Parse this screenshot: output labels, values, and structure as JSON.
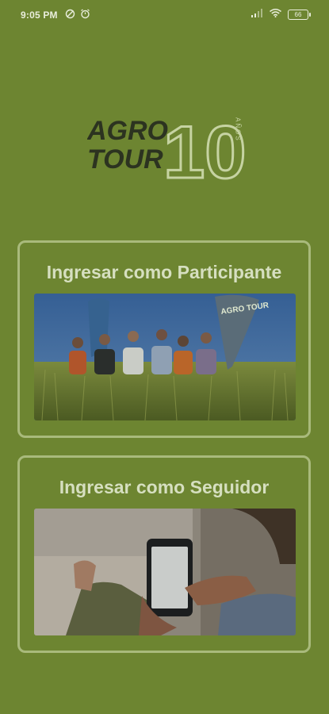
{
  "status_bar": {
    "time": "9:05 PM",
    "left_icons": [
      "at-sign-icon",
      "alarm-icon"
    ],
    "right_icons": [
      "signal-icon",
      "wifi-icon",
      "battery-icon"
    ],
    "battery_level": "66"
  },
  "logo": {
    "line1": "AGRO",
    "line2": "TOUR",
    "number": "10",
    "suffix": "AÑOS"
  },
  "participant_card": {
    "title": "Ingresar como Participante",
    "image_icon": "group-in-wheat-field-photo",
    "flag_text": "AGRO TOUR"
  },
  "follower_card": {
    "title": "Ingresar como Seguidor",
    "image_icon": "person-holding-phone-photo"
  },
  "colors": {
    "background": "#6d8531",
    "card_border": "#a9ba7c",
    "title_text": "#d6dfc0",
    "logo_dark": "#2c3320"
  }
}
